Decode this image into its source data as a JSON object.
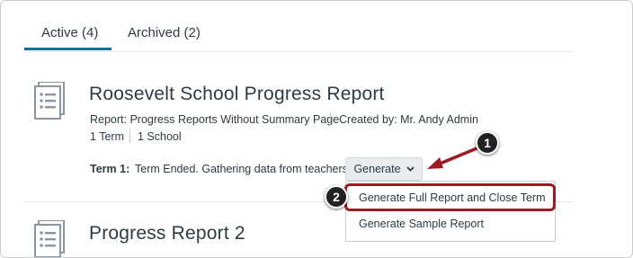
{
  "tabs": [
    {
      "label": "Active (4)"
    },
    {
      "label": "Archived (2)"
    }
  ],
  "reports": [
    {
      "title": "Roosevelt School Progress Report",
      "report_type": "Report: Progress Reports Without Summary Page",
      "created_by": "Created by: Mr. Andy Admin",
      "terms": "1 Term",
      "schools": "1 School",
      "term_label": "Term 1:",
      "term_status": "Term Ended. Gathering data from teachers.",
      "generate_label": "Generate"
    },
    {
      "title": "Progress Report 2"
    }
  ],
  "generate_menu": {
    "items": [
      {
        "label": "Generate Full Report and Close Term"
      },
      {
        "label": "Generate Sample Report"
      }
    ]
  },
  "callouts": {
    "one": "1",
    "two": "2"
  },
  "colors": {
    "accent": "#0770a3",
    "highlight": "#9e1b22",
    "text": "#2d3b45"
  }
}
